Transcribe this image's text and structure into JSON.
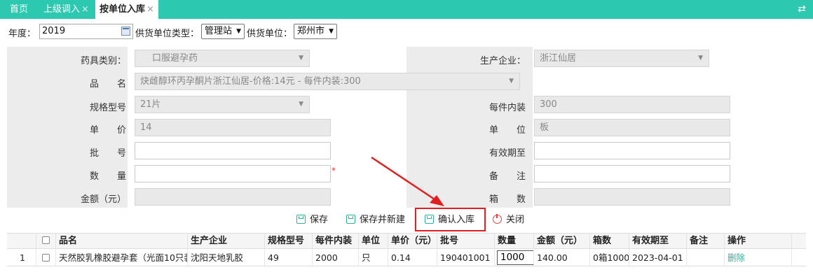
{
  "tabs": [
    {
      "label": "首页"
    },
    {
      "label": "上级调入",
      "close": "×"
    },
    {
      "label": "按单位入库",
      "close": "×"
    }
  ],
  "filters": {
    "year_label": "年度：",
    "year_value": "2019",
    "supplier_type_label": "供货单位类型：",
    "supplier_type_value": "管理站",
    "supplier_label": "供货单位：",
    "supplier_value": "郑州市"
  },
  "form": {
    "drug_category_label": "药具类别：",
    "drug_category_value": "口服避孕药",
    "manufacturer_label": "生产企业：",
    "manufacturer_value": "浙江仙居",
    "product_label": "品　　名",
    "product_value": "炔雌醇环丙孕酮片浙江仙居-价格:14元 - 每件内装:300",
    "spec_label": "规格型号",
    "spec_value": "21片",
    "per_pack_label": "每件内装",
    "per_pack_value": "300",
    "unit_price_label": "单　　价",
    "unit_price_value": "14",
    "unit_label": "单　　位",
    "unit_value": "板",
    "batch_label": "批　　号",
    "batch_value": "",
    "expiry_label": "有效期至",
    "expiry_value": "",
    "quantity_label": "数　　量",
    "quantity_value": "",
    "required_mark": "*",
    "remark_label": "备　　注",
    "remark_value": "",
    "amount_label": "金额（元）",
    "amount_value": "",
    "boxes_label": "箱　　数",
    "boxes_value": ""
  },
  "actions": {
    "save": "保存",
    "save_new": "保存并新建",
    "confirm": "确认入库",
    "close": "关闭"
  },
  "table": {
    "headers": [
      "品名",
      "生产企业",
      "规格型号",
      "每件内装",
      "单位",
      "单价（元）",
      "批号",
      "数量",
      "金额（元）",
      "箱数",
      "有效期至",
      "备注",
      "操作"
    ],
    "rows": [
      {
        "index": "1",
        "name": "天然胶乳橡胶避孕套（光面10只装",
        "manufacturer": "沈阳天地乳胶",
        "spec": "49",
        "per_pack": "2000",
        "unit": "只",
        "price": "0.14",
        "batch": "190401001",
        "quantity": "1000",
        "amount": "140.00",
        "boxes": "0箱1000只",
        "expiry": "2023-04-01",
        "remark": "",
        "op": "删除"
      }
    ]
  },
  "colors": {
    "accent": "#2cc8b0",
    "highlight": "#e02020"
  }
}
